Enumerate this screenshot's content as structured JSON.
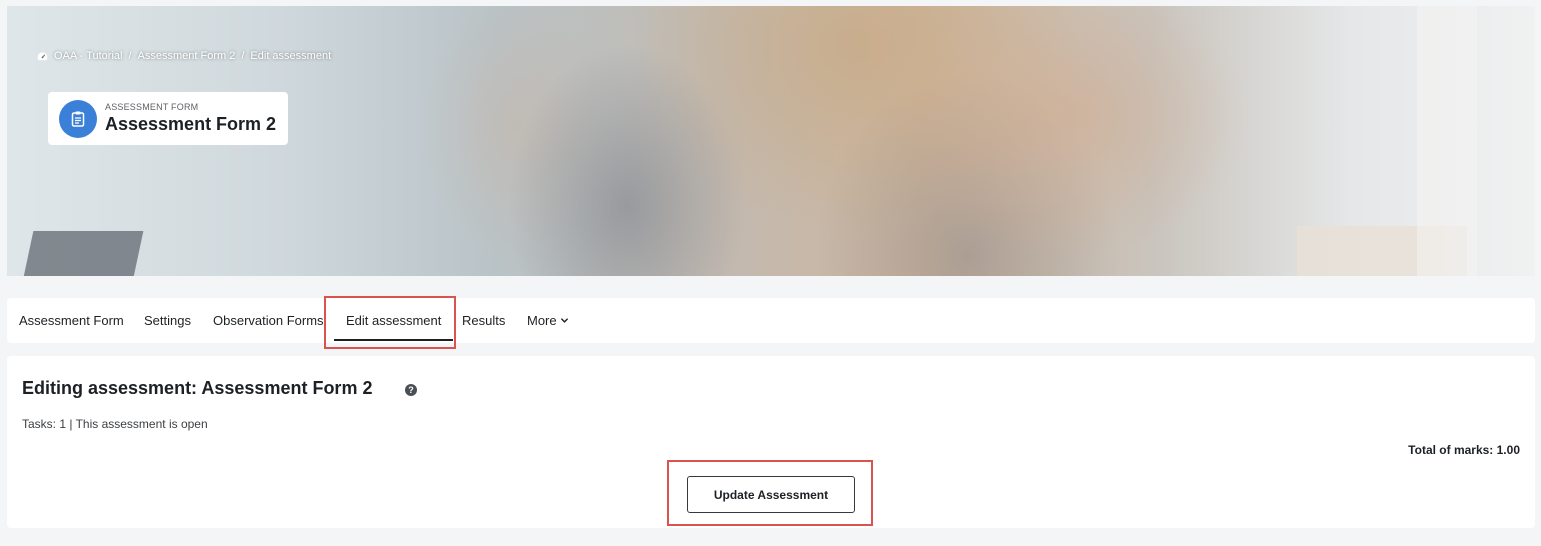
{
  "breadcrumb": {
    "items": [
      "OAA - Tutorial",
      "Assessment Form 2",
      "Edit assessment"
    ],
    "separator": "/"
  },
  "header": {
    "kicker": "ASSESSMENT FORM",
    "title": "Assessment Form 2"
  },
  "nav": {
    "tabs": [
      {
        "label": "Assessment Form"
      },
      {
        "label": "Settings"
      },
      {
        "label": "Observation Forms"
      },
      {
        "label": "Edit assessment",
        "active": true
      },
      {
        "label": "Results"
      },
      {
        "label": "More"
      }
    ]
  },
  "main": {
    "title": "Editing assessment: Assessment Form 2",
    "help": "?",
    "status": "Tasks: 1 | This assessment is open",
    "total_marks": "Total of marks: 1.00",
    "update_label": "Update Assessment"
  },
  "colors": {
    "accent": "#3b80d8",
    "highlight": "#d9534f",
    "text": "#1d2125",
    "background": "#f4f5f7"
  },
  "icons": {
    "breadcrumb_home": "dashboard-icon",
    "header": "clipboard-icon",
    "more": "chevron-down-icon",
    "help": "question-circle-icon"
  }
}
